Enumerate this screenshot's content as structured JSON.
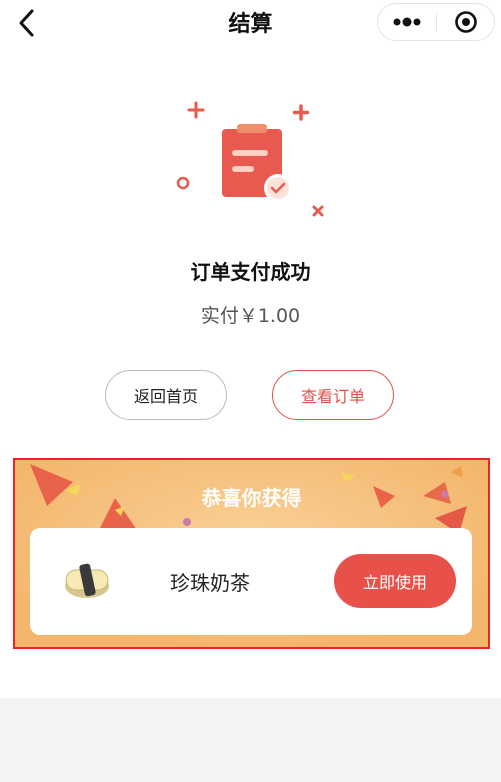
{
  "nav": {
    "title": "结算",
    "back_icon": "chevron-left-icon",
    "more_icon": "more-dots-icon",
    "target_icon": "target-circle-icon"
  },
  "status": {
    "illustration_icon": "clipboard-check-icon",
    "title": "订单支付成功",
    "paid_text": "实付￥1.00"
  },
  "actions": {
    "home_label": "返回首页",
    "order_label": "查看订单"
  },
  "reward": {
    "title": "恭喜你获得",
    "item_name": "珍珠奶茶",
    "item_icon": "sushi-icon",
    "use_label": "立即使用",
    "colors": {
      "banner": "#f6c17d",
      "accent": "#e8504a",
      "highlight_border": "#ea2424"
    }
  }
}
